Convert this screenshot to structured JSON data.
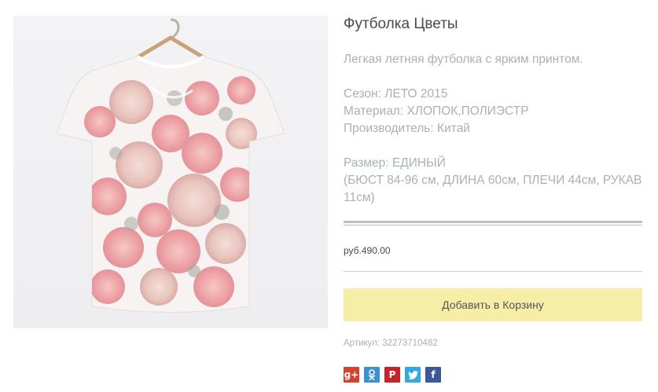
{
  "product": {
    "title": "Футболка Цветы",
    "description": "Легкая летняя футболка с ярким принтом.",
    "season": "Сезон: ЛЕТО 2015",
    "material": "Материал: ХЛОПОК,ПОЛИЭСТР",
    "manufacturer": "Производитель: Китай",
    "size": "Размер: ЕДИНЫЙ",
    "size_details": "(БЮСТ 84-96 см, ДЛИНА 60см, ПЛЕЧИ 44см, РУКАВ 11см)",
    "price": "руб.490.00",
    "sku": "Артикул: 32273710482"
  },
  "actions": {
    "add_to_cart_label": "Добавить в Корзину"
  },
  "social": [
    {
      "icon": "google-plus-icon",
      "glyph": "g+",
      "color": "#d44332"
    },
    {
      "icon": "odnoklassniki-icon",
      "glyph": "ok",
      "color": "#3b8fd4"
    },
    {
      "icon": "pinterest-icon",
      "glyph": "P",
      "color": "#c8232c"
    },
    {
      "icon": "twitter-icon",
      "glyph": "t",
      "color": "#2fa9e0"
    },
    {
      "icon": "facebook-icon",
      "glyph": "f",
      "color": "#3b5998"
    }
  ]
}
